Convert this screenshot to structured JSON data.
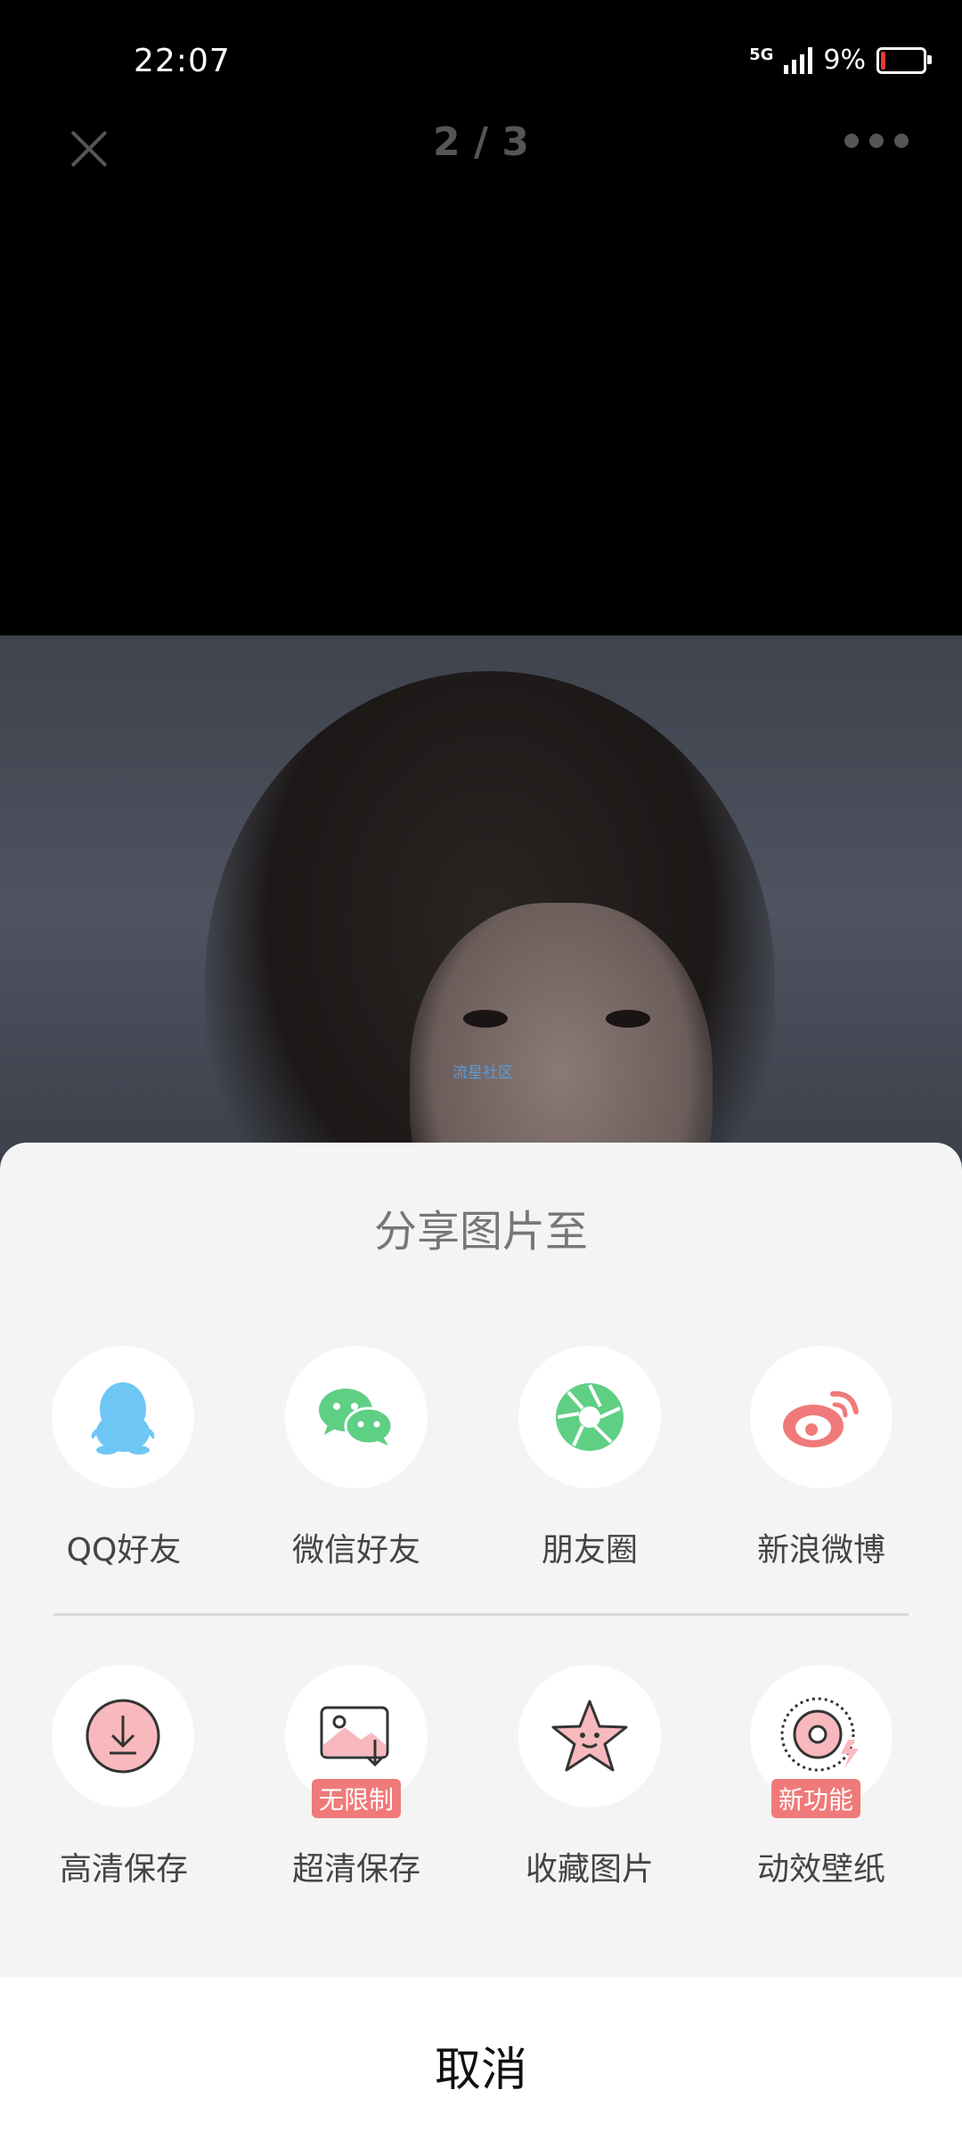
{
  "status_bar": {
    "time": "22:07",
    "network": "5G",
    "battery": "9%"
  },
  "nav": {
    "page_counter": "2 / 3"
  },
  "photo": {
    "watermark": "流星社区"
  },
  "share_sheet": {
    "title": "分享图片至",
    "share_targets": [
      {
        "label": "QQ好友",
        "icon": "qq-penguin-icon",
        "color": "#6ec6f5"
      },
      {
        "label": "微信好友",
        "icon": "wechat-icon",
        "color": "#5fcf84"
      },
      {
        "label": "朋友圈",
        "icon": "moments-shutter-icon",
        "color": "#5fcf84"
      },
      {
        "label": "新浪微博",
        "icon": "weibo-icon",
        "color": "#f07a7a"
      }
    ],
    "actions": [
      {
        "label": "高清保存",
        "icon": "download-icon",
        "badge": ""
      },
      {
        "label": "超清保存",
        "icon": "image-download-icon",
        "badge": "无限制"
      },
      {
        "label": "收藏图片",
        "icon": "star-face-icon",
        "badge": ""
      },
      {
        "label": "动效壁纸",
        "icon": "live-wallpaper-icon",
        "badge": "新功能"
      }
    ],
    "cancel_label": "取消"
  },
  "colors": {
    "accent_pink": "#f07a7a",
    "sheet_bg": "#f4f4f4"
  }
}
